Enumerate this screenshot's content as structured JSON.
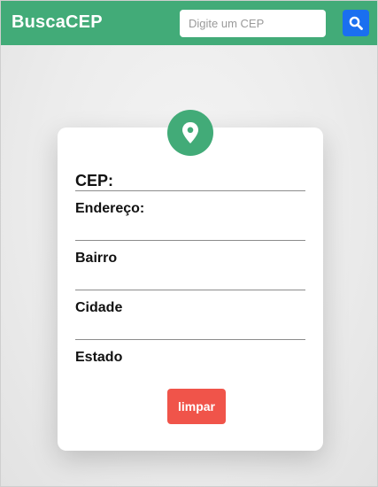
{
  "header": {
    "brand": "BuscaCEP",
    "search_placeholder": "Digite um CEP",
    "search_icon": "search-icon"
  },
  "card": {
    "icon": "map-pin-icon",
    "fields": {
      "cep": "CEP:",
      "endereco": "Endereço:",
      "bairro": "Bairro",
      "cidade": "Cidade",
      "estado": "Estado"
    },
    "clear_label": "limpar"
  },
  "colors": {
    "brand_green": "#42ab78",
    "search_blue": "#1a6ff0",
    "clear_red": "#f0544a"
  }
}
